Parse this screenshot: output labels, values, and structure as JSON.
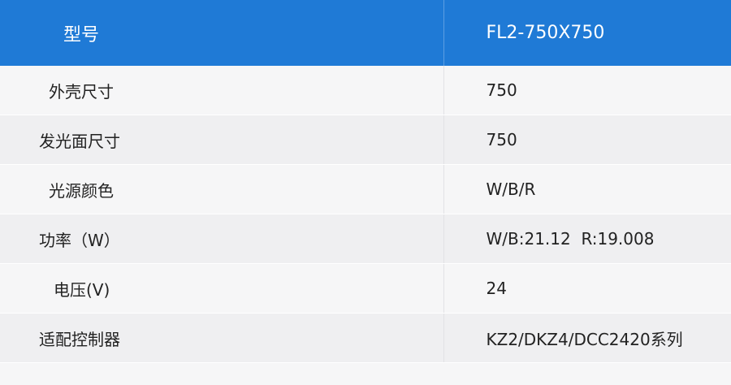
{
  "header": {
    "label": "型号",
    "value": "FL2-750X750"
  },
  "rows": [
    {
      "label": "外壳尺寸",
      "value": "750"
    },
    {
      "label": "发光面尺寸",
      "value": "750"
    },
    {
      "label": "光源颜色",
      "value": "W/B/R"
    },
    {
      "label": "功率（W）",
      "value": "W/B:21.12  R:19.008"
    },
    {
      "label": "电压(V)",
      "value": "24"
    },
    {
      "label": "适配控制器",
      "value": "KZ2/DKZ4/DCC2420系列"
    }
  ],
  "colors": {
    "header_bg": "#1f7ad6",
    "row_odd": "#f6f6f7",
    "row_even": "#efeff1"
  }
}
